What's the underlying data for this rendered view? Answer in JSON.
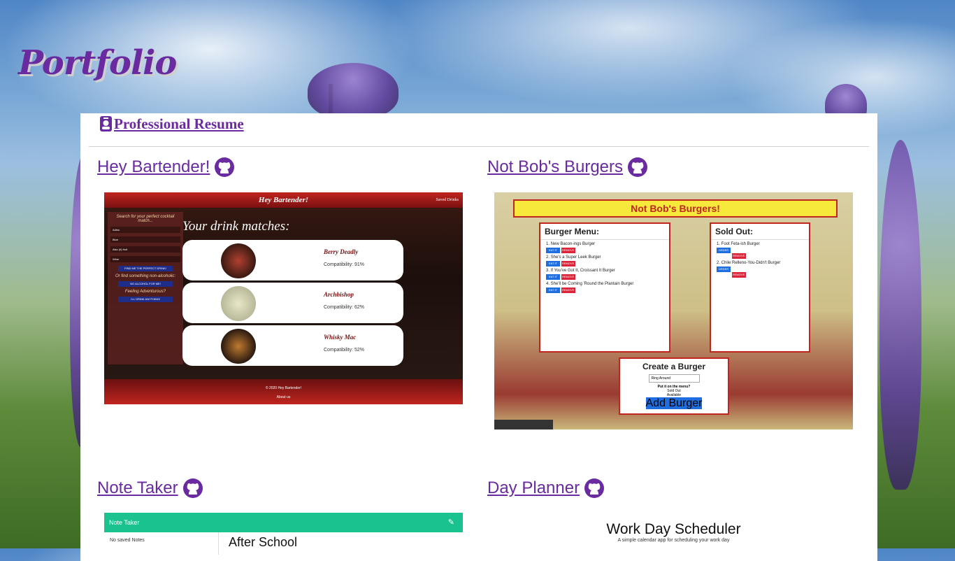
{
  "page": {
    "title": "Portfolio"
  },
  "resume": {
    "label": "Professional Resume"
  },
  "projects": [
    {
      "name": "Hey Bartender!",
      "preview": {
        "header": "Hey Bartender!",
        "saved": "Saved Drinks",
        "sidebar_heading": "Search for your perfect cocktail match...",
        "select_1": "Adieu",
        "select_2": "Blue",
        "select_3": "Also (it) fruit",
        "select_4": "Wine",
        "find_button": "FIND ME THE PERFECT DRINK!",
        "or_nonalc": "Or find something non-alcoholic:",
        "no_alcohol_button": "NO ALCOHOL FOR ME!",
        "feeling": "Feeling Adventurous?",
        "anything_button": "I'LL DRINK ANYTHING!",
        "matches_heading": "Your drink matches:",
        "drinks": [
          {
            "name": "Berry Deadly",
            "compat": "Compatibility: 91%"
          },
          {
            "name": "Archbishop",
            "compat": "Compatibility: 62%"
          },
          {
            "name": "Whisky Mac",
            "compat": "Compatibility: 52%"
          }
        ],
        "footer_copy": "© 2020 Hey Bartender!",
        "footer_about": "About us"
      }
    },
    {
      "name": "Not Bob's Burgers",
      "preview": {
        "banner": "Not Bob's Burgers!",
        "menu_heading": "Burger Menu:",
        "menu_items": [
          "1. New Bacon-ings Burger",
          "2. She's a Super Leek Burger",
          "3. If You've Got It, Croissant It Burger",
          "4. She'll be Coming 'Round the Plantain Burger"
        ],
        "eat_label": "EAT IT",
        "remove_label": "REMOVE",
        "soldout_heading": "Sold Out:",
        "soldout_items": [
          "1. Foot Feta-ish Burger",
          "2. Chile Relleno-You-Didn't Burger"
        ],
        "order_label": "ORDER UP",
        "create_heading": "Create a Burger",
        "create_input": "Ring Around",
        "put_on_menu": "Put it on the menu?",
        "opt_soldout": "Sold Out",
        "opt_available": "Available",
        "add_button": "Add Burger"
      }
    },
    {
      "name": "Note Taker",
      "preview": {
        "app_title": "Note Taker",
        "no_notes": "No saved Notes",
        "note_title": "After School"
      }
    },
    {
      "name": "Day Planner",
      "preview": {
        "heading": "Work Day Scheduler",
        "subheading": "A simple calendar app for scheduling your work day"
      }
    }
  ],
  "colors": {
    "accent": "#6a2aa0",
    "panel": "#ffffff"
  },
  "icons": {
    "resume": "id-badge-icon",
    "repo": "github-icon"
  }
}
